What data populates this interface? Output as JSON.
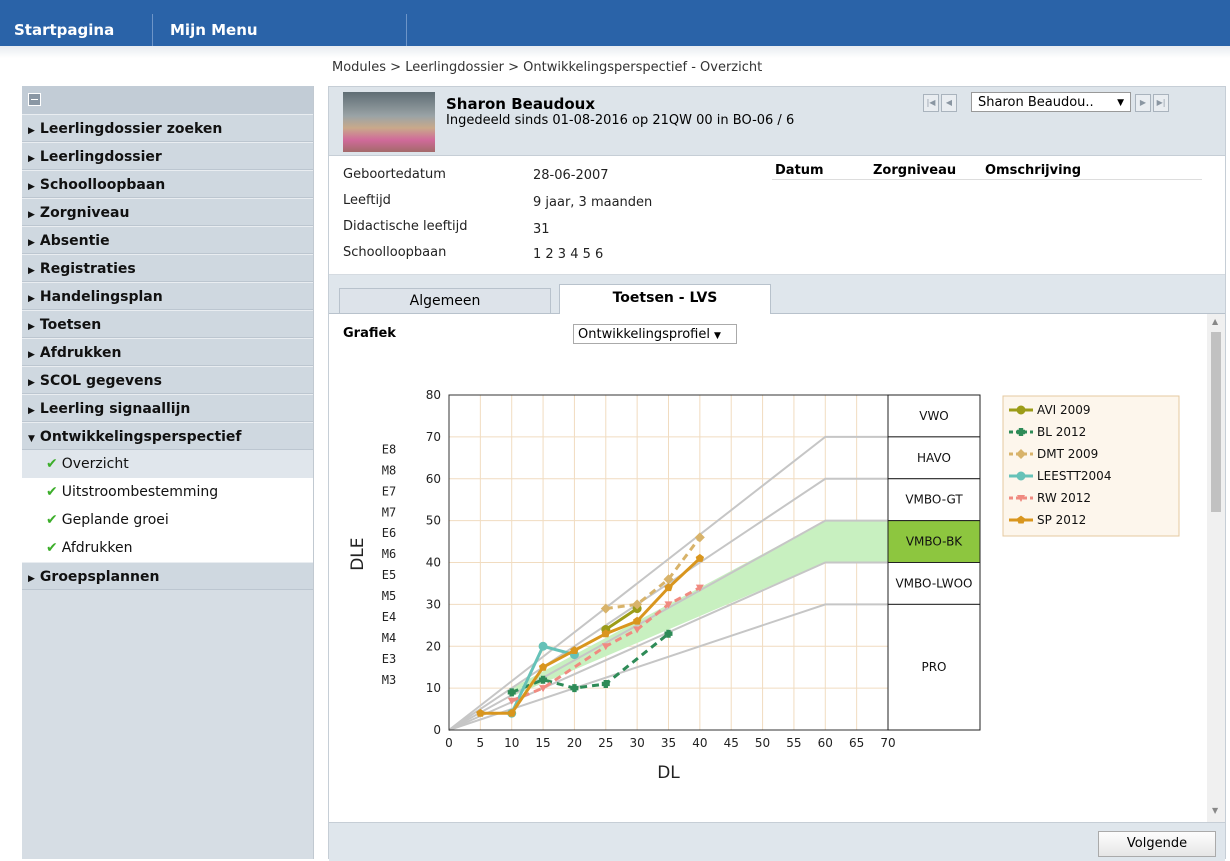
{
  "topnav": {
    "home": "Startpagina",
    "menu": "Mijn Menu"
  },
  "breadcrumb": "Modules > Leerlingdossier > Ontwikkelingsperspectief - Overzicht",
  "sidebar": {
    "items": [
      {
        "label": "Leerlingdossier zoeken"
      },
      {
        "label": "Leerlingdossier"
      },
      {
        "label": "Schoolloopbaan"
      },
      {
        "label": "Zorgniveau"
      },
      {
        "label": "Absentie"
      },
      {
        "label": "Registraties"
      },
      {
        "label": "Handelingsplan"
      },
      {
        "label": "Toetsen"
      },
      {
        "label": "Afdrukken"
      },
      {
        "label": "SCOL gegevens"
      },
      {
        "label": "Leerling signaallijn"
      },
      {
        "label": "Ontwikkelingsperspectief"
      }
    ],
    "subitems": [
      {
        "label": "Overzicht"
      },
      {
        "label": "Uitstroombestemming"
      },
      {
        "label": "Geplande groei"
      },
      {
        "label": "Afdrukken"
      }
    ],
    "last": {
      "label": "Groepsplannen"
    }
  },
  "student": {
    "name": "Sharon Beaudoux",
    "ingedeeld": "Ingedeeld sinds 01-08-2016 op 21QW 00 in BO-06 / 6",
    "select_value": "Sharon Beaudou.."
  },
  "info": {
    "geboortedatum_label": "Geboortedatum",
    "geboortedatum": "28-06-2007",
    "leeftijd_label": "Leeftijd",
    "leeftijd": "9 jaar, 3 maanden",
    "didactische_label": "Didactische leeftijd",
    "didactische": "31",
    "schoolloopbaan_label": "Schoolloopbaan",
    "schoolloopbaan": "1 2 3 4 5 6",
    "col_datum": "Datum",
    "col_zorgniveau": "Zorgniveau",
    "col_omschrijving": "Omschrijving"
  },
  "tabs": {
    "algemeen": "Algemeen",
    "toetsen": "Toetsen - LVS"
  },
  "grafiek": {
    "label": "Grafiek",
    "select": "Ontwikkelingsprofiel"
  },
  "footer": {
    "next": "Volgende"
  },
  "colors": {
    "topbar": "#2a63a8",
    "vmbo_bk": "#8dc63f",
    "band": "#c8f0c0"
  },
  "chart_data": {
    "type": "line",
    "xlabel": "DL",
    "ylabel": "DLE",
    "xlim": [
      0,
      70
    ],
    "ylim": [
      0,
      80
    ],
    "xticks": [
      0,
      5,
      10,
      15,
      20,
      25,
      30,
      35,
      40,
      45,
      50,
      55,
      60,
      65,
      70
    ],
    "yticks": [
      0,
      10,
      20,
      30,
      40,
      50,
      60,
      70,
      80
    ],
    "grid": true,
    "level_labels": [
      {
        "y": 67,
        "label": "E8"
      },
      {
        "y": 62,
        "label": "M8"
      },
      {
        "y": 57,
        "label": "E7"
      },
      {
        "y": 52,
        "label": "M7"
      },
      {
        "y": 47,
        "label": "E6"
      },
      {
        "y": 42,
        "label": "M6"
      },
      {
        "y": 37,
        "label": "E5"
      },
      {
        "y": 32,
        "label": "M5"
      },
      {
        "y": 27,
        "label": "E4"
      },
      {
        "y": 22,
        "label": "M4"
      },
      {
        "y": 17,
        "label": "E3"
      },
      {
        "y": 12,
        "label": "M3"
      }
    ],
    "reference_lines": [
      {
        "name": "VWO/HAVO",
        "points": [
          [
            0,
            0
          ],
          [
            60,
            70
          ],
          [
            70,
            70
          ]
        ]
      },
      {
        "name": "HAVO/VMBO-GT",
        "points": [
          [
            0,
            0
          ],
          [
            60,
            60
          ],
          [
            70,
            60
          ]
        ]
      },
      {
        "name": "VMBO-GT/VMBO-BK",
        "points": [
          [
            0,
            0
          ],
          [
            60,
            50
          ],
          [
            70,
            50
          ]
        ]
      },
      {
        "name": "VMBO-BK/VMBO-LWOO",
        "points": [
          [
            0,
            0
          ],
          [
            60,
            40
          ],
          [
            70,
            40
          ]
        ]
      },
      {
        "name": "VMBO-LWOO/PRO",
        "points": [
          [
            0,
            0
          ],
          [
            60,
            30
          ],
          [
            70,
            30
          ]
        ]
      }
    ],
    "band": {
      "upper": [
        [
          10,
          10
        ],
        [
          60,
          50
        ],
        [
          70,
          50
        ]
      ],
      "lower": [
        [
          10,
          8
        ],
        [
          60,
          40
        ],
        [
          70,
          40
        ]
      ]
    },
    "zones": [
      {
        "label": "VWO",
        "from": 70,
        "to": 80,
        "highlight": false
      },
      {
        "label": "HAVO",
        "from": 60,
        "to": 70,
        "highlight": false
      },
      {
        "label": "VMBO-GT",
        "from": 50,
        "to": 60,
        "highlight": false
      },
      {
        "label": "VMBO-BK",
        "from": 40,
        "to": 50,
        "highlight": true
      },
      {
        "label": "VMBO-LWOO",
        "from": 30,
        "to": 40,
        "highlight": false
      },
      {
        "label": "PRO",
        "from": 0,
        "to": 30,
        "highlight": false
      }
    ],
    "series": [
      {
        "name": "AVI 2009",
        "color": "#9c9c18",
        "dash": false,
        "marker": "circle",
        "points": [
          [
            25,
            24
          ],
          [
            30,
            29
          ]
        ]
      },
      {
        "name": "BL 2012",
        "color": "#2e8b57",
        "dash": true,
        "marker": "cross",
        "points": [
          [
            10,
            9
          ],
          [
            15,
            12
          ],
          [
            20,
            10
          ],
          [
            25,
            11
          ],
          [
            35,
            23
          ]
        ]
      },
      {
        "name": "DMT 2009",
        "color": "#d8b36a",
        "dash": true,
        "marker": "diamond",
        "points": [
          [
            25,
            29
          ],
          [
            30,
            30
          ],
          [
            35,
            36
          ],
          [
            40,
            46
          ]
        ]
      },
      {
        "name": "LEESTT2004",
        "color": "#66c2b8",
        "dash": false,
        "marker": "circle",
        "points": [
          [
            10,
            4
          ],
          [
            15,
            20
          ],
          [
            20,
            18
          ]
        ]
      },
      {
        "name": "RW 2012",
        "color": "#f08a80",
        "dash": true,
        "marker": "triangle",
        "points": [
          [
            10,
            7
          ],
          [
            15,
            10
          ],
          [
            25,
            20
          ],
          [
            30,
            24
          ],
          [
            35,
            30
          ],
          [
            40,
            34
          ]
        ]
      },
      {
        "name": "SP 2012",
        "color": "#d9961e",
        "dash": false,
        "marker": "pentagon",
        "points": [
          [
            5,
            4
          ],
          [
            10,
            4
          ],
          [
            15,
            15
          ],
          [
            20,
            19
          ],
          [
            25,
            23
          ],
          [
            30,
            26
          ],
          [
            35,
            34
          ],
          [
            40,
            41
          ]
        ]
      }
    ]
  }
}
